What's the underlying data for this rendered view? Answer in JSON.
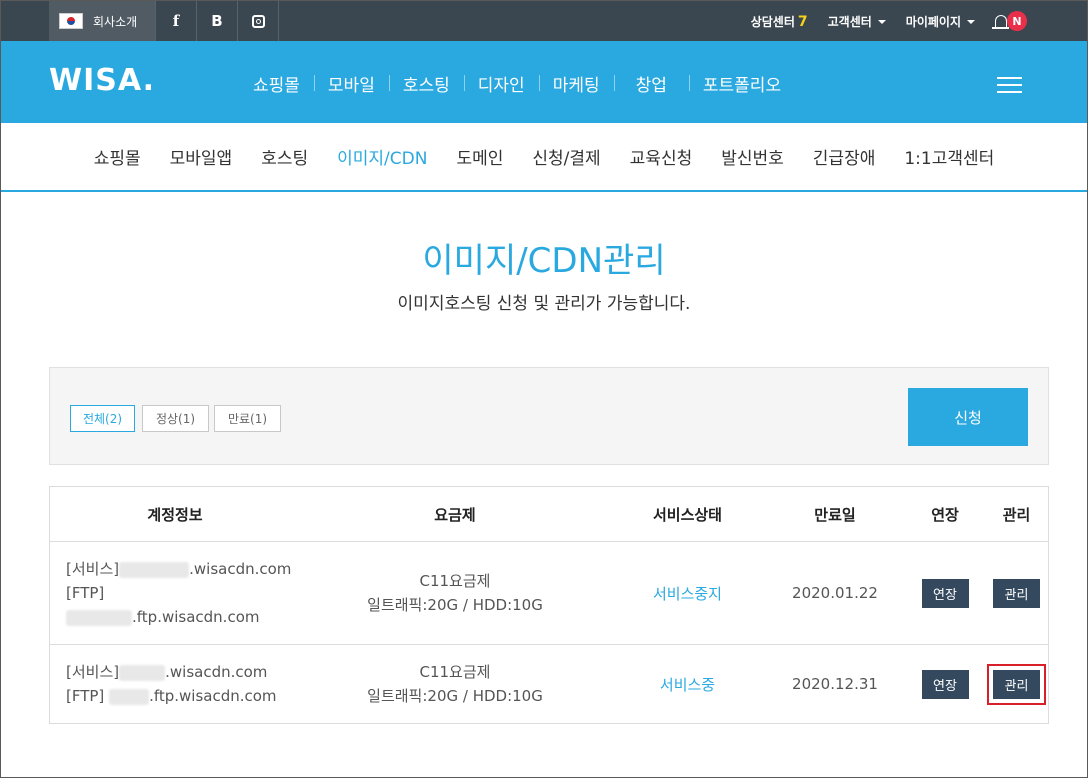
{
  "topbar": {
    "company_label": "회사소개",
    "facebook": "f",
    "blog": "B",
    "consult_label": "상담센터",
    "consult_num": "7",
    "customer_label": "고객센터",
    "mypage_label": "마이페이지",
    "notif_badge": "N"
  },
  "nav": {
    "logo": "WISA.",
    "items": [
      "쇼핑몰",
      "모바일",
      "호스팅",
      "디자인",
      "마케팅",
      "창업",
      "포트폴리오"
    ]
  },
  "subnav": {
    "items": [
      "쇼핑몰",
      "모바일앱",
      "호스팅",
      "이미지/CDN",
      "도메인",
      "신청/결제",
      "교육신청",
      "발신번호",
      "긴급장애",
      "1:1고객센터"
    ],
    "active_index": 3
  },
  "page": {
    "title": "이미지/CDN관리",
    "subtitle": "이미지호스팅 신청 및 관리가 가능합니다."
  },
  "filters": {
    "all": "전체(2)",
    "normal": "정상(1)",
    "expired": "만료(1)",
    "apply_label": "신청"
  },
  "table": {
    "headers": [
      "계정정보",
      "요금제",
      "서비스상태",
      "만료일",
      "연장",
      "관리"
    ],
    "rows": [
      {
        "service_prefix": "[서비스]",
        "service_domain": ".wisacdn.com",
        "ftp_prefix": "[FTP]",
        "ftp_domain": ".ftp.wisacdn.com",
        "plan_name": "C11요금제",
        "plan_detail": "일트래픽:20G / HDD:10G",
        "status": "서비스중지",
        "expire": "2020.01.22",
        "extend_label": "연장",
        "manage_label": "관리"
      },
      {
        "service_prefix": "[서비스]",
        "service_domain": ".wisacdn.com",
        "ftp_prefix": "[FTP]",
        "ftp_domain": ".ftp.wisacdn.com",
        "plan_name": "C11요금제",
        "plan_detail": "일트래픽:20G / HDD:10G",
        "status": "서비스중",
        "expire": "2020.12.31",
        "extend_label": "연장",
        "manage_label": "관리"
      }
    ]
  },
  "colors": {
    "accent": "#2aa9e0",
    "topbar": "#3a4650",
    "highlight": "#d9202a",
    "button_dark": "#34495e"
  }
}
